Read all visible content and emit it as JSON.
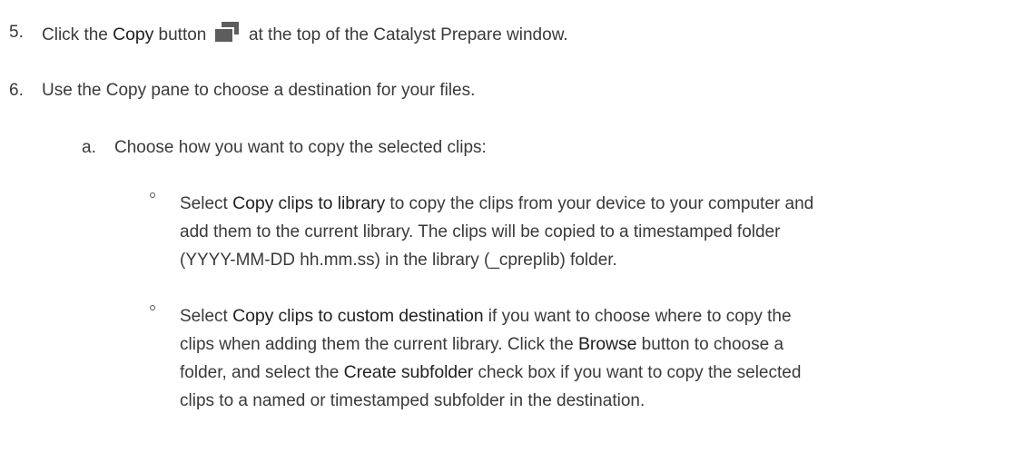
{
  "steps": [
    {
      "number": "5.",
      "pre": "Click the ",
      "bold": "Copy",
      "mid": " button",
      "post": "at the top of the Catalyst Prepare window."
    },
    {
      "number": "6.",
      "text": "Use the Copy pane to choose a destination for your files."
    }
  ],
  "substep": {
    "letter": "a.",
    "text": "Choose how you want to copy the selected clips:"
  },
  "bullets": [
    {
      "lines": [
        {
          "pre": "Select ",
          "bold": "Copy clips to library",
          "post": " to copy the clips from your device to your computer and"
        },
        {
          "text": "add them to the current library. The clips will be copied to a timestamped folder"
        },
        {
          "text": "(YYYY-MM-DD hh.mm.ss) in the library (_cpreplib) folder."
        }
      ]
    },
    {
      "lines": [
        {
          "pre": "Select ",
          "bold": "Copy clips to custom destination",
          "post": " if you want to choose where to copy the"
        },
        {
          "pre": "clips when adding them the current library. Click the ",
          "bold": "Browse",
          "post": " button to choose a"
        },
        {
          "pre": "folder, and select the ",
          "bold": "Create subfolder",
          "post": " check box if you want to copy the selected"
        },
        {
          "text": "clips to a named or timestamped subfolder in the destination."
        }
      ]
    }
  ],
  "icons": {
    "copy_button": "copy-icon"
  }
}
